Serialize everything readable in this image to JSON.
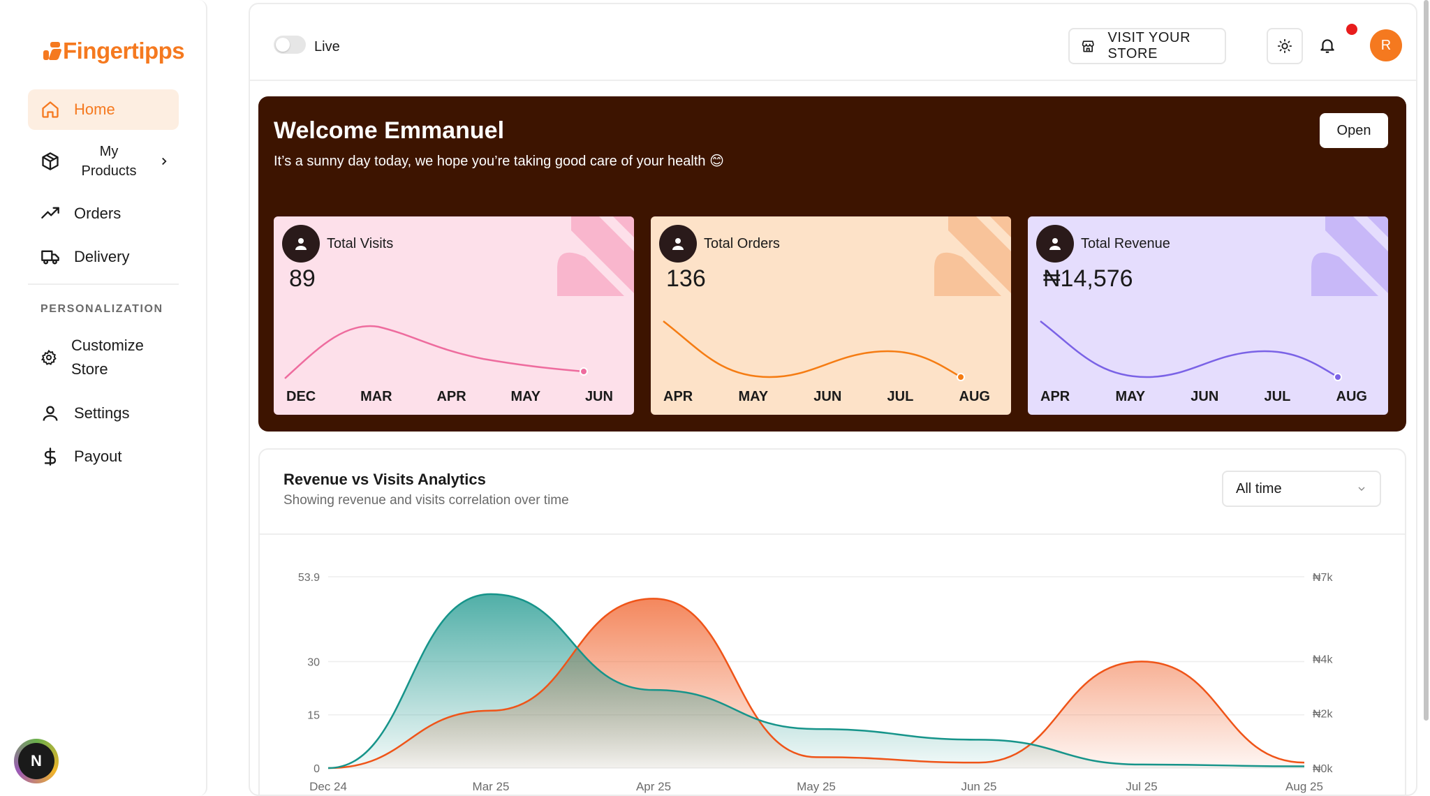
{
  "sidebar": {
    "logo": "Fingertipps",
    "items": [
      {
        "label": "Home"
      },
      {
        "label": "My Products"
      },
      {
        "label": "Orders"
      },
      {
        "label": "Delivery"
      }
    ],
    "section_label": "PERSONALIZATION",
    "personalization": [
      {
        "label": "Customize Store"
      },
      {
        "label": "Settings"
      },
      {
        "label": "Payout"
      }
    ],
    "badge": "N"
  },
  "topbar": {
    "live_label": "Live",
    "visit_store_label": "VISIT YOUR STORE",
    "avatar_initial": "R"
  },
  "banner": {
    "title": "Welcome Emmanuel",
    "subtitle": "It’s a sunny day today, we hope you’re taking good care of your health 😊",
    "open_label": "Open",
    "cards": [
      {
        "label": "Total Visits",
        "value": "89",
        "months": [
          "DEC",
          "MAR",
          "APR",
          "MAY",
          "JUN"
        ],
        "bg": "#fde0ea",
        "line": "#ee6c9e",
        "deco": "#f9b6cd"
      },
      {
        "label": "Total Orders",
        "value": "136",
        "months": [
          "APR",
          "MAY",
          "JUN",
          "JUL",
          "AUG"
        ],
        "bg": "#fde2c8",
        "line": "#f57c13",
        "deco": "#f8c39a"
      },
      {
        "label": "Total Revenue",
        "value": "₦14,576",
        "months": [
          "APR",
          "MAY",
          "JUN",
          "JUL",
          "AUG"
        ],
        "bg": "#e5ddfd",
        "line": "#7a62e6",
        "deco": "#c8b8f8"
      }
    ]
  },
  "analytics": {
    "title": "Revenue vs Visits Analytics",
    "subtitle": "Showing revenue and visits correlation over time",
    "range_label": "All time"
  },
  "chart_data": {
    "type": "area",
    "x": [
      "Dec 24",
      "Mar 25",
      "Apr 25",
      "May 25",
      "Jun 25",
      "Jul 25",
      "Aug 25"
    ],
    "left_axis_ticks": [
      "53.9",
      "30",
      "15",
      "0"
    ],
    "right_axis_ticks": [
      "₦7k",
      "₦4k",
      "₦2k",
      "₦0k"
    ],
    "series": [
      {
        "name": "visits",
        "axis": "left",
        "color": "#16948a",
        "values": [
          0,
          49,
          22,
          11,
          8,
          1,
          0.5
        ]
      },
      {
        "name": "revenue",
        "axis": "right",
        "color": "#ef5418",
        "values": [
          0,
          2100,
          6200,
          400,
          200,
          3900,
          200
        ]
      }
    ],
    "grid": true
  }
}
